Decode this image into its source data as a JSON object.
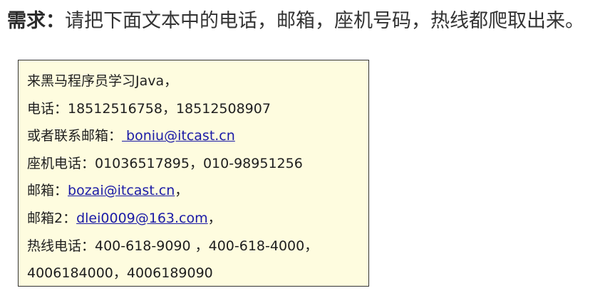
{
  "heading": {
    "lead": "需求：",
    "text": "请把下面文本中的电话，邮箱，座机号码，热线都爬取出来。"
  },
  "content": {
    "line1": "来黑马程序员学习Java，",
    "line2": "电话：18512516758，18512508907",
    "line3_prefix": "或者联系邮箱：",
    "line3_email": " boniu@itcast.cn",
    "line4": "座机电话：01036517895，010-98951256",
    "line5_prefix": "邮箱：",
    "line5_email": "bozai@itcast.cn",
    "line5_suffix": "，",
    "line6_prefix": "邮箱2：",
    "line6_email": "dlei0009@163.com",
    "line6_suffix": "，",
    "line7": "热线电话：400-618-9090 ，400-618-4000，",
    "line8": "4006184000，4006189090"
  },
  "colors": {
    "box_background": "#fefcdf",
    "link": "#1a1aa6"
  }
}
